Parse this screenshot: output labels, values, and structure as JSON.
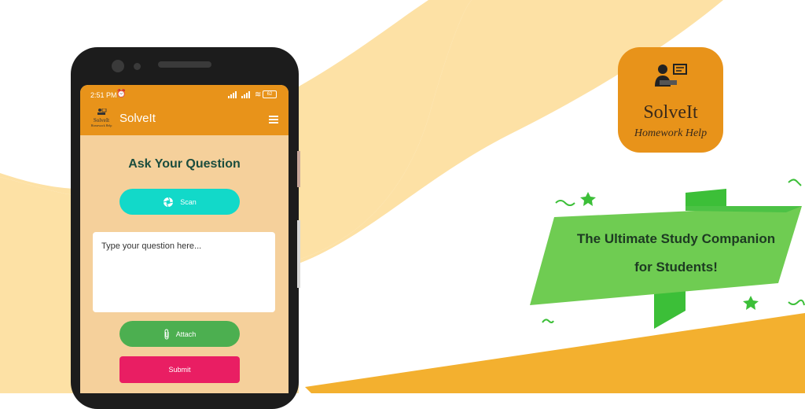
{
  "colors": {
    "accent_orange": "#e8931a",
    "screen_bg": "#f5d09b",
    "scan_button": "#12d9c9",
    "attach_button": "#4caf50",
    "submit_button": "#e91e63",
    "title_green": "#1b4d3e",
    "banner_green": "#6fcc52"
  },
  "status_bar": {
    "time": "2:51 PM",
    "alarm_icon": "alarm-clock-icon",
    "battery": "62"
  },
  "app_bar": {
    "logo_text": "SolveIt",
    "logo_subtext": "Homework Help",
    "title": "SolveIt",
    "menu_icon": "hamburger-menu-icon"
  },
  "main": {
    "heading": "Ask Your Question",
    "scan_label": "Scan",
    "question_placeholder": "Type your question here...",
    "attach_label": "Attach",
    "submit_label": "Submit"
  },
  "app_icon": {
    "name": "SolveIt",
    "subtitle": "Homework Help"
  },
  "banner": {
    "line1": "The Ultimate Study Companion",
    "line2": "for Students!"
  }
}
